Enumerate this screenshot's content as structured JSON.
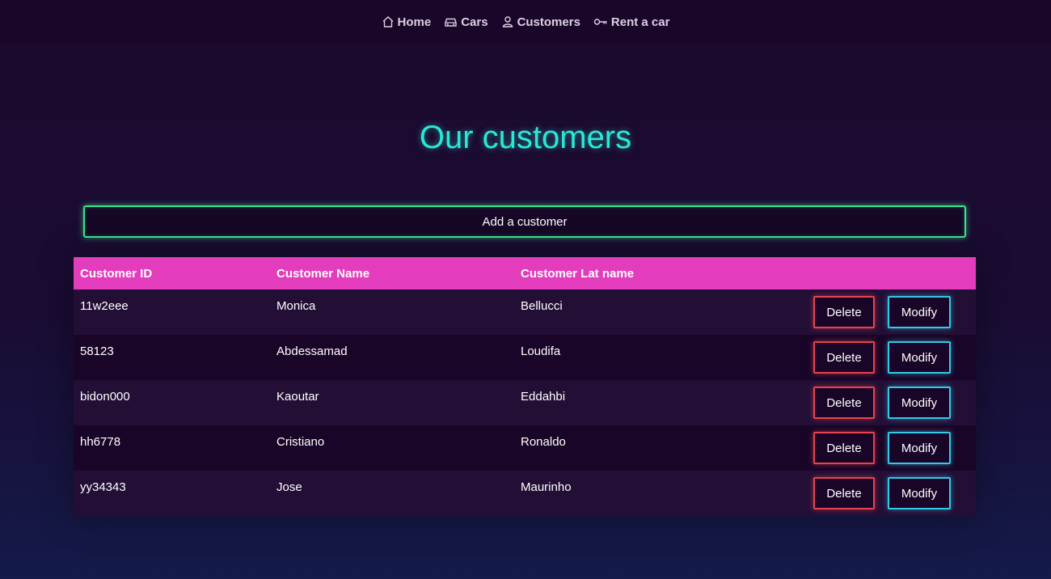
{
  "nav": {
    "items": [
      {
        "label": "Home",
        "icon": "home-icon"
      },
      {
        "label": "Cars",
        "icon": "car-icon"
      },
      {
        "label": "Customers",
        "icon": "user-icon"
      },
      {
        "label": "Rent a car",
        "icon": "key-icon"
      }
    ]
  },
  "page": {
    "title": "Our customers",
    "add_button_label": "Add a customer"
  },
  "table": {
    "headers": [
      "Customer ID",
      "Customer Name",
      "Customer Lat name"
    ],
    "delete_label": "Delete",
    "modify_label": "Modify",
    "rows": [
      {
        "id": "11w2eee",
        "name": "Monica",
        "last_name": "Bellucci"
      },
      {
        "id": "58123",
        "name": "Abdessamad",
        "last_name": "Loudifa"
      },
      {
        "id": "bidon000",
        "name": "Kaoutar",
        "last_name": "Eddahbi"
      },
      {
        "id": "hh6778",
        "name": "Cristiano",
        "last_name": "Ronaldo"
      },
      {
        "id": "yy34343",
        "name": "Jose",
        "last_name": "Maurinho"
      }
    ]
  },
  "colors": {
    "title": "#2be8d6",
    "header_bg": "#e33dbd",
    "add_border": "#39e58c",
    "delete_border": "#e8434f",
    "modify_border": "#33c9e8"
  }
}
